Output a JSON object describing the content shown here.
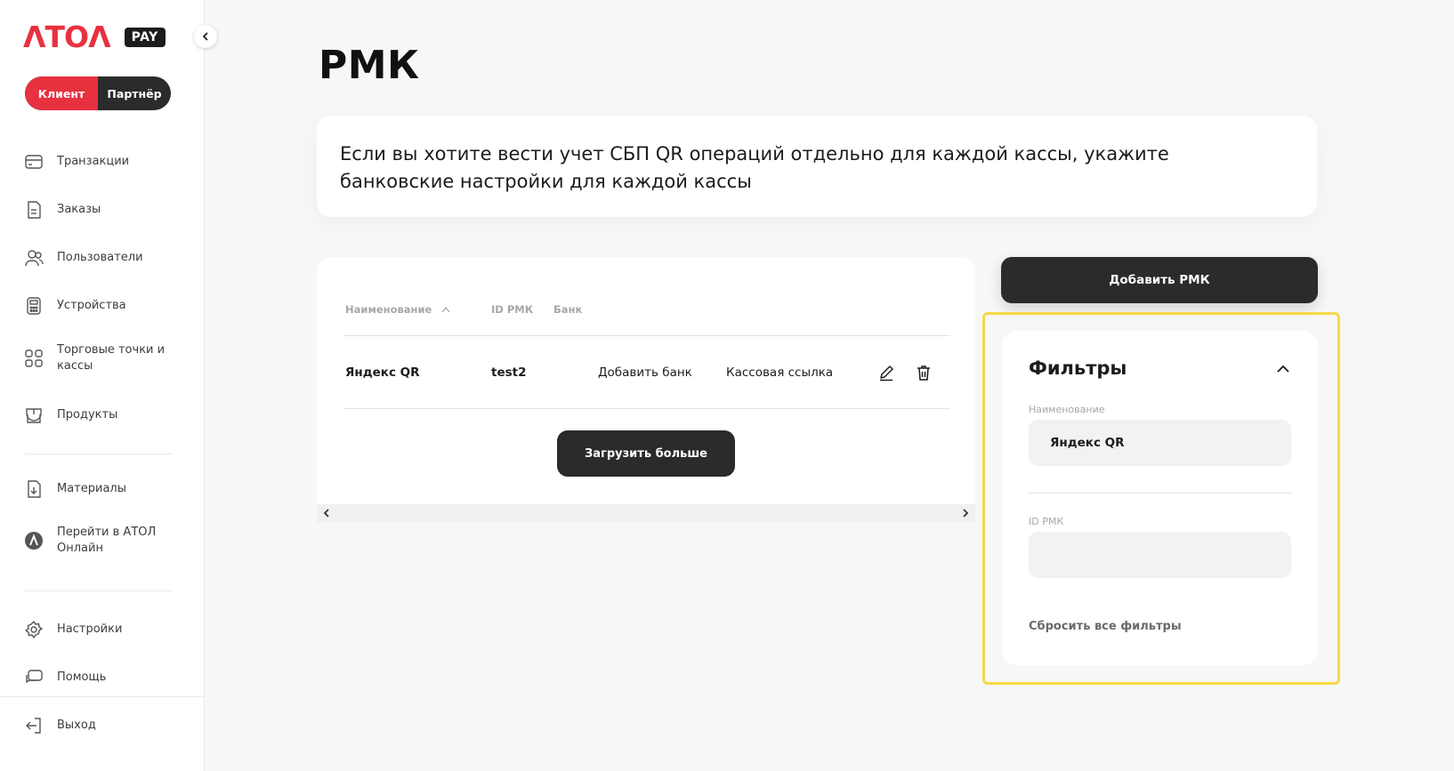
{
  "brand": {
    "logo": "ΛTOΛ",
    "badge": "PAY",
    "accent": "#e8313f"
  },
  "role_switch": {
    "client": "Клиент",
    "partner": "Партнёр",
    "active": "client"
  },
  "nav": {
    "transactions": "Транзакции",
    "orders": "Заказы",
    "users": "Пользователи",
    "devices": "Устройства",
    "stores_line1": "Торговые точки и",
    "stores_line2": "кассы",
    "products": "Продукты",
    "materials": "Материалы",
    "atol_online_line1": "Перейти в АТОЛ",
    "atol_online_line2": "Онлайн",
    "settings": "Настройки",
    "help": "Помощь",
    "logout": "Выход"
  },
  "page": {
    "title": "РМК",
    "info": "Если вы хотите вести учет СБП QR операций отдельно для каждой кассы, укажите банковские настройки для каждой кассы"
  },
  "table": {
    "headers": {
      "name": "Наименование",
      "id": "ID РМК",
      "bank": "Банк"
    },
    "rows": [
      {
        "name": "Яндекс QR",
        "id": "test2",
        "bank": "Добавить банк",
        "link": "Кассовая ссылка"
      }
    ],
    "load_more": "Загрузить больше"
  },
  "add_button": "Добавить РМК",
  "filters": {
    "title": "Фильтры",
    "name_label": "Наименование",
    "name_value": "Яндекс QR",
    "id_label": "ID РМК",
    "id_value": "",
    "reset": "Сбросить все фильтры",
    "highlight_color": "#f7d849"
  }
}
